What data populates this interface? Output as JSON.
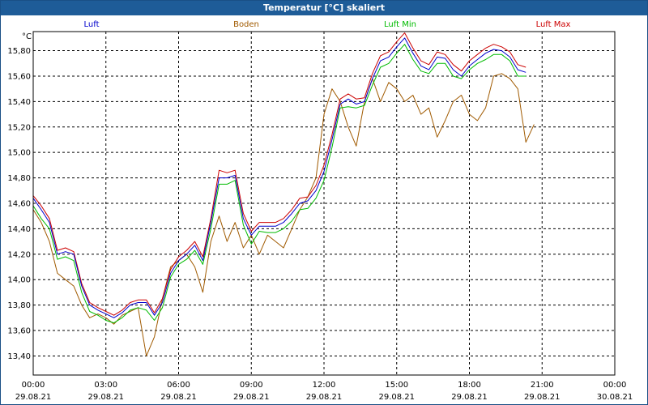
{
  "chart_data": {
    "type": "line",
    "title": "Temperatur [°C] skaliert",
    "ylabel": "°C",
    "ylim": [
      13.25,
      15.95
    ],
    "yticks": [
      13.4,
      13.6,
      13.8,
      14.0,
      14.2,
      14.4,
      14.6,
      14.8,
      15.0,
      15.2,
      15.4,
      15.6,
      15.8
    ],
    "ytick_labels": [
      "13,40",
      "13,60",
      "13,80",
      "14,00",
      "14,20",
      "14,40",
      "14,60",
      "14,80",
      "15,00",
      "15,20",
      "15,40",
      "15,60",
      "15,80"
    ],
    "x_ticks": [
      {
        "time": "00:00",
        "date": "29.08.21"
      },
      {
        "time": "03:00",
        "date": "29.08.21"
      },
      {
        "time": "06:00",
        "date": "29.08.21"
      },
      {
        "time": "09:00",
        "date": "29.08.21"
      },
      {
        "time": "12:00",
        "date": "29.08.21"
      },
      {
        "time": "15:00",
        "date": "29.08.21"
      },
      {
        "time": "18:00",
        "date": "29.08.21"
      },
      {
        "time": "21:00",
        "date": "29.08.21"
      },
      {
        "time": "00:00",
        "date": "30.08.21"
      }
    ],
    "x_hours": [
      0,
      0.33,
      0.67,
      1,
      1.33,
      1.67,
      2,
      2.33,
      2.67,
      3,
      3.33,
      3.67,
      4,
      4.33,
      4.67,
      5,
      5.33,
      5.67,
      6,
      6.33,
      6.67,
      7,
      7.33,
      7.67,
      8,
      8.33,
      8.67,
      9,
      9.33,
      9.67,
      10,
      10.33,
      10.67,
      11,
      11.33,
      11.67,
      12,
      12.33,
      12.67,
      13,
      13.33,
      13.67,
      14,
      14.33,
      14.67,
      15,
      15.33,
      15.67,
      16,
      16.33,
      16.67,
      17,
      17.33,
      17.67,
      18,
      18.33,
      18.67,
      19,
      19.33,
      19.67,
      20,
      20.33,
      20.67,
      21,
      21.33,
      21.67,
      22,
      22.33,
      22.67,
      23,
      23.33,
      23.67,
      24
    ],
    "grid": true,
    "legend_position": "top",
    "series": [
      {
        "name": "Luft",
        "color": "#0000cc",
        "values": [
          14.64,
          14.55,
          14.45,
          14.2,
          14.22,
          14.2,
          13.95,
          13.8,
          13.76,
          13.73,
          13.7,
          13.74,
          13.8,
          13.82,
          13.82,
          13.72,
          13.82,
          14.05,
          14.15,
          14.2,
          14.27,
          14.15,
          14.45,
          14.8,
          14.8,
          14.82,
          14.48,
          14.35,
          14.42,
          14.42,
          14.42,
          14.45,
          14.52,
          14.6,
          14.62,
          14.7,
          14.85,
          15.1,
          15.38,
          15.42,
          15.38,
          15.4,
          15.58,
          15.72,
          15.75,
          15.83,
          15.9,
          15.78,
          15.68,
          15.65,
          15.75,
          15.74,
          15.65,
          15.6,
          15.68,
          15.73,
          15.78,
          15.81,
          15.8,
          15.75,
          15.65,
          15.63
        ]
      },
      {
        "name": "Boden",
        "color": "#a05a00",
        "values": [
          14.55,
          14.45,
          14.3,
          14.05,
          14.0,
          13.95,
          13.8,
          13.7,
          13.73,
          13.7,
          13.65,
          13.72,
          13.75,
          13.78,
          13.4,
          13.55,
          13.85,
          14.1,
          14.15,
          14.2,
          14.1,
          13.9,
          14.3,
          14.5,
          14.3,
          14.45,
          14.25,
          14.35,
          14.2,
          14.35,
          14.3,
          14.25,
          14.4,
          14.55,
          14.65,
          14.8,
          15.3,
          15.5,
          15.4,
          15.2,
          15.05,
          15.4,
          15.58,
          15.4,
          15.55,
          15.5,
          15.4,
          15.45,
          15.3,
          15.35,
          15.12,
          15.25,
          15.4,
          15.45,
          15.3,
          15.25,
          15.35,
          15.6,
          15.62,
          15.58,
          15.5,
          15.08,
          15.22
        ]
      },
      {
        "name": "Luft Min",
        "color": "#00bb00",
        "values": [
          14.58,
          14.48,
          14.4,
          14.16,
          14.18,
          14.15,
          13.9,
          13.75,
          13.72,
          13.68,
          13.66,
          13.7,
          13.76,
          13.78,
          13.76,
          13.68,
          13.78,
          14.02,
          14.12,
          14.16,
          14.23,
          14.12,
          14.4,
          14.75,
          14.75,
          14.78,
          14.43,
          14.28,
          14.38,
          14.37,
          14.37,
          14.4,
          14.46,
          14.55,
          14.56,
          14.64,
          14.78,
          15.04,
          15.35,
          15.36,
          15.35,
          15.37,
          15.53,
          15.67,
          15.7,
          15.78,
          15.85,
          15.73,
          15.64,
          15.62,
          15.7,
          15.7,
          15.6,
          15.58,
          15.65,
          15.7,
          15.73,
          15.77,
          15.77,
          15.72,
          15.6,
          15.6
        ]
      },
      {
        "name": "Luft Max",
        "color": "#cc0000",
        "values": [
          14.66,
          14.58,
          14.48,
          14.23,
          14.25,
          14.22,
          13.97,
          13.82,
          13.78,
          13.75,
          13.72,
          13.76,
          13.82,
          13.84,
          13.84,
          13.74,
          13.85,
          14.08,
          14.18,
          14.23,
          14.3,
          14.18,
          14.48,
          14.86,
          14.84,
          14.86,
          14.52,
          14.38,
          14.45,
          14.45,
          14.45,
          14.48,
          14.55,
          14.64,
          14.65,
          14.74,
          14.9,
          15.14,
          15.42,
          15.46,
          15.42,
          15.43,
          15.62,
          15.76,
          15.79,
          15.87,
          15.94,
          15.82,
          15.72,
          15.69,
          15.79,
          15.77,
          15.69,
          15.64,
          15.72,
          15.77,
          15.82,
          15.85,
          15.83,
          15.79,
          15.69,
          15.67
        ]
      }
    ]
  }
}
